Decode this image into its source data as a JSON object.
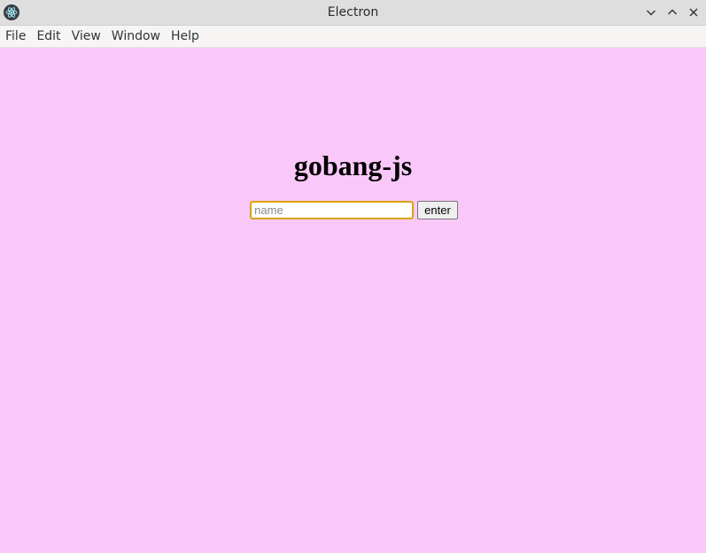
{
  "window": {
    "title": "Electron",
    "icon": "electron-icon",
    "controls": [
      "minimize-icon",
      "maximize-icon",
      "close-icon"
    ]
  },
  "menubar": {
    "items": [
      "File",
      "Edit",
      "View",
      "Window",
      "Help"
    ]
  },
  "main": {
    "heading": "gobang-js",
    "name_input": {
      "value": "",
      "placeholder": "name"
    },
    "enter_label": "enter"
  },
  "colors": {
    "background": "#f9c8f9",
    "input_focus_border": "#d9a400",
    "titlebar": "#dedede",
    "menubar": "#f6f5f4"
  }
}
